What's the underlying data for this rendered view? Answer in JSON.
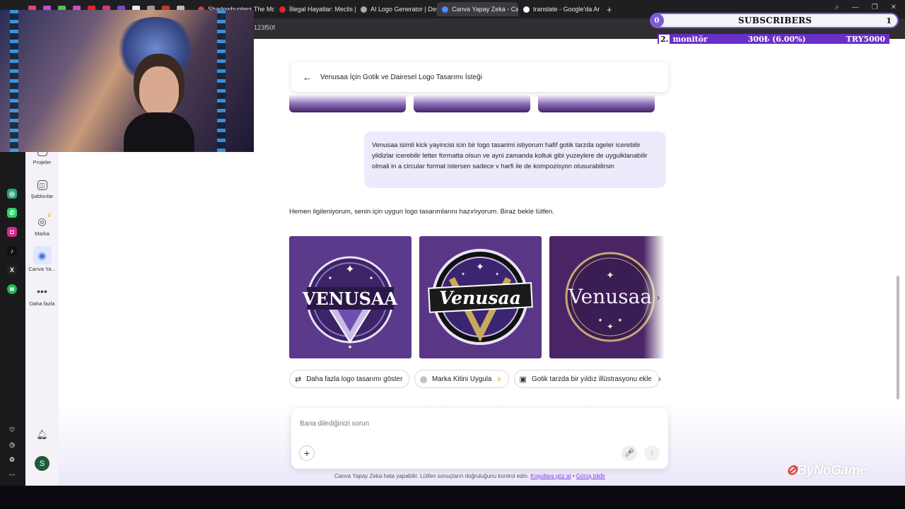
{
  "browser": {
    "tabs": [
      {
        "label": "Shadowhunters The Mort",
        "color": "#d33a3a",
        "active": false
      },
      {
        "label": "İllegal Hayatlar: Meclis | Fi",
        "color": "#e0242b",
        "active": false
      },
      {
        "label": "AI Logo Generator | Desig",
        "color": "#aaaaaa",
        "active": false
      },
      {
        "label": "Canva Yapay Zeka - Canva",
        "color": "#4a8cff",
        "active": true
      },
      {
        "label": "translate - Google'da Ara",
        "color": "#ffffff",
        "active": false
      }
    ],
    "new_tab": "+",
    "url": "123f50f"
  },
  "overlay": {
    "subscribers": {
      "left_count": "0",
      "label": "SUBSCRIBERS",
      "right_count": "1"
    },
    "ticker": {
      "rank": "2.",
      "name": "monitör",
      "amount": "300₺ (6.00%)",
      "goal": "TRY5000"
    },
    "watermark": "ByNoGame"
  },
  "sidebar": {
    "items": [
      {
        "label": "Projeler",
        "icon": "folder-icon"
      },
      {
        "label": "Şablonlar",
        "icon": "templates-icon"
      },
      {
        "label": "Marka",
        "icon": "brand-icon"
      },
      {
        "label": "Canva Ya...",
        "icon": "canva-ai-icon"
      },
      {
        "label": "Daha fazla",
        "icon": "more-icon"
      }
    ],
    "avatar": "S"
  },
  "chat": {
    "title": "Venusaa İçin Gotik ve Dairesel Logo Tasarımı İsteği",
    "user_message": "Venusaa isimli kick yayincisi icin bir logo tasarimi istiyorum hafif gotik tarzda ogeler icerebilir  yildizlar icerebilir letter formatta olsun ve ayni zamanda koltuk gibi yuzeylere de uygulklanabilir olmali in a circular format istersen sadece v harfi ile de kompozisyon olusurabilirsin",
    "ai_message": "Hemen ilgileniyorum, senin için uygun logo tasarımlarını hazırlıyorum. Biraz bekle lütfen.",
    "logos": [
      {
        "text": "VENUSAA",
        "bg": "#5b3a8c"
      },
      {
        "text": "Venusaa",
        "bg": "#5a3687"
      },
      {
        "text": "Venusaa",
        "bg": "#4a2566"
      }
    ],
    "chips": [
      {
        "label": "Daha fazla logo tasarımı göster",
        "icon": "shuffle-icon"
      },
      {
        "label": "Marka Kitini Uygula",
        "icon": "brand-kit-icon"
      },
      {
        "label": "Gotik tarzda bir yıldız illüstrasyonu ekle",
        "icon": "image-icon"
      }
    ],
    "composer_placeholder": "Bana dilediğinizi sorun",
    "disclaimer": "Canva Yapay Zeka hata yapabilir. Lütfen sonuçların doğruluğunu kontrol edin.",
    "disclaimer_link1": "Koşullara göz at",
    "disclaimer_sep": "•",
    "disclaimer_link2": "Görüş bildir"
  }
}
